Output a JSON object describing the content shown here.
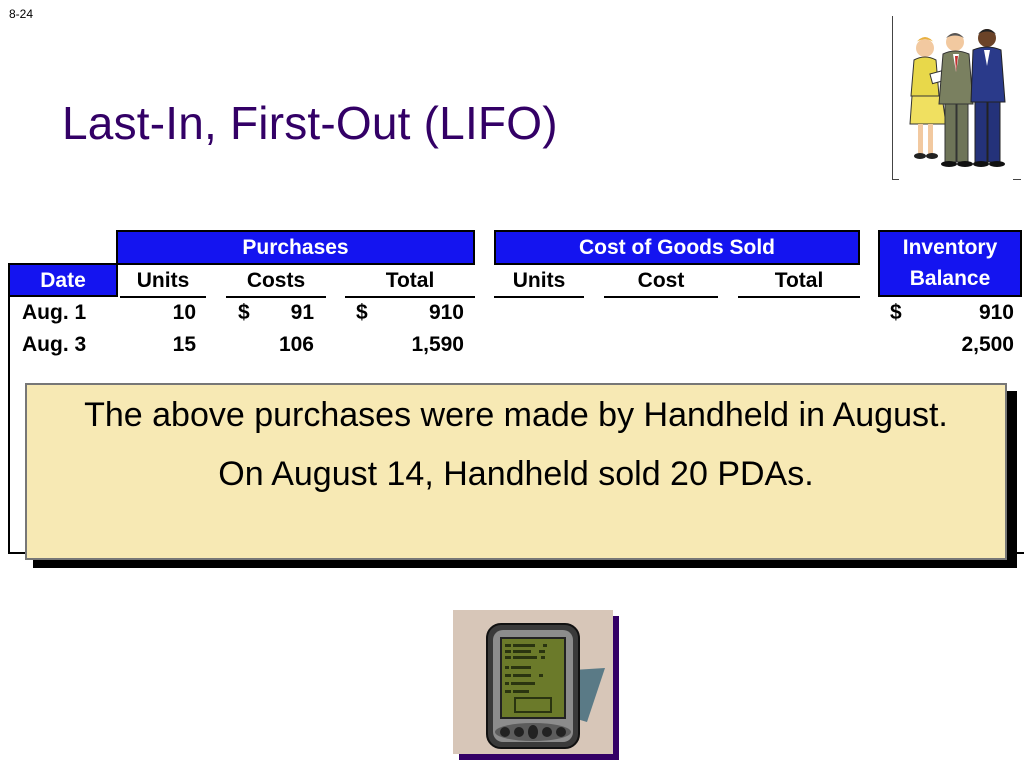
{
  "slide": {
    "number": "8-24",
    "title": "Last-In, First-Out (LIFO)"
  },
  "table": {
    "group_headers": {
      "purchases": "Purchases",
      "cogs": "Cost of Goods Sold",
      "inventory_line1": "Inventory",
      "inventory_line2": "Balance"
    },
    "date_header": "Date",
    "purchase_columns": [
      "Units",
      "Costs",
      "Total"
    ],
    "cogs_columns": [
      "Units",
      "Cost",
      "Total"
    ],
    "rows": [
      {
        "date": "Aug. 1",
        "units": "10",
        "cost_sym": "$",
        "cost": "91",
        "total_sym": "$",
        "total": "910",
        "bal_sym": "$",
        "balance": "910"
      },
      {
        "date": "Aug. 3",
        "units": "15",
        "cost_sym": "",
        "cost": "106",
        "total_sym": "",
        "total": "1,590",
        "bal_sym": "",
        "balance": "2,500"
      }
    ]
  },
  "callout": {
    "line1": "The above purchases were made by Handheld in August.",
    "line2": "On August 14, Handheld sold 20 PDAs."
  },
  "icons": {
    "people": "business-people-icon",
    "pda": "pda-device-icon"
  }
}
